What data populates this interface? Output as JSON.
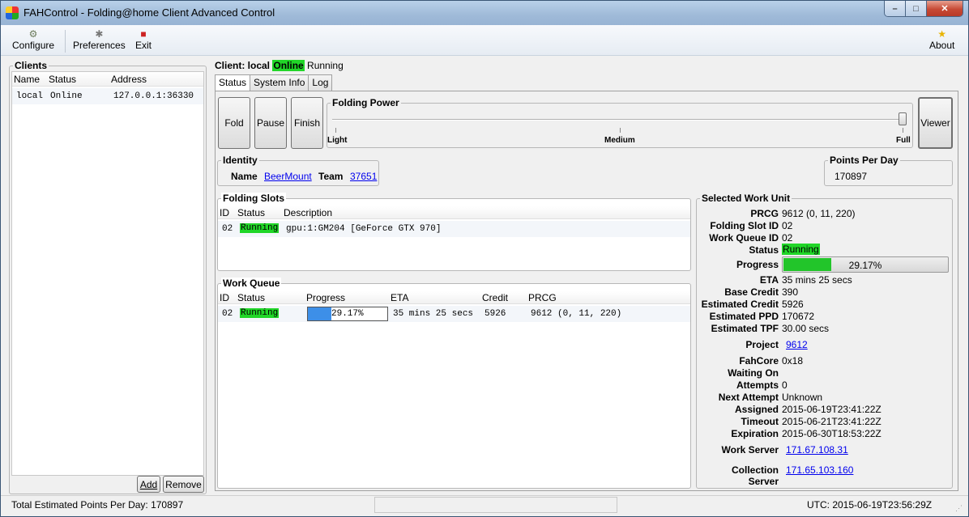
{
  "window": {
    "title": "FAHControl - Folding@home Client Advanced Control"
  },
  "toolbar": {
    "configure": "Configure",
    "preferences": "Preferences",
    "exit": "Exit",
    "about": "About"
  },
  "clients": {
    "title": "Clients",
    "columns": [
      "Name",
      "Status",
      "Address"
    ],
    "rows": [
      {
        "name": "local",
        "status": "Online",
        "address": "127.0.0.1:36330"
      }
    ],
    "add_label": "Add",
    "remove_label": "Remove"
  },
  "client_header": {
    "prefix": "Client: local",
    "online": "Online",
    "state": "Running"
  },
  "tabs": [
    "Status",
    "System Info",
    "Log"
  ],
  "controls": {
    "fold": "Fold",
    "pause": "Pause",
    "finish": "Finish",
    "viewer": "Viewer"
  },
  "folding_power": {
    "title": "Folding Power",
    "light": "Light",
    "medium": "Medium",
    "full": "Full",
    "level": 1.0
  },
  "identity": {
    "title": "Identity",
    "name_label": "Name",
    "name": "BeerMount",
    "team_label": "Team",
    "team": "37651"
  },
  "ppd": {
    "title": "Points Per Day",
    "value": "170897"
  },
  "slots": {
    "title": "Folding Slots",
    "columns": [
      "ID",
      "Status",
      "Description"
    ],
    "rows": [
      {
        "id": "02",
        "status": "Running",
        "description": "gpu:1:GM204 [GeForce GTX 970]"
      }
    ]
  },
  "queue": {
    "title": "Work Queue",
    "columns": [
      "ID",
      "Status",
      "Progress",
      "ETA",
      "Credit",
      "PRCG"
    ],
    "rows": [
      {
        "id": "02",
        "status": "Running",
        "progress": "29.17%",
        "progress_value": 0.2917,
        "eta": "35 mins 25 secs",
        "credit": "5926",
        "prcg": "9612 (0, 11, 220)"
      }
    ]
  },
  "wu": {
    "title": "Selected Work Unit",
    "prcg_label": "PRCG",
    "prcg": "9612 (0, 11, 220)",
    "slot_label": "Folding Slot ID",
    "slot": "02",
    "queue_label": "Work Queue ID",
    "queue": "02",
    "status_label": "Status",
    "status": "Running",
    "progress_label": "Progress",
    "progress": "29.17%",
    "progress_value": 0.2917,
    "eta_label": "ETA",
    "eta": "35 mins 25 secs",
    "base_credit_label": "Base Credit",
    "base_credit": "390",
    "est_credit_label": "Estimated Credit",
    "est_credit": "5926",
    "est_ppd_label": "Estimated PPD",
    "est_ppd": "170672",
    "est_tpf_label": "Estimated TPF",
    "est_tpf": "30.00 secs",
    "project_label": "Project",
    "project": "9612",
    "fahcore_label": "FahCore",
    "fahcore": "0x18",
    "waiting_label": "Waiting On",
    "waiting": "",
    "attempts_label": "Attempts",
    "attempts": "0",
    "next_attempt_label": "Next Attempt",
    "next_attempt": "Unknown",
    "assigned_label": "Assigned",
    "assigned": "2015-06-19T23:41:22Z",
    "timeout_label": "Timeout",
    "timeout": "2015-06-21T23:41:22Z",
    "expiration_label": "Expiration",
    "expiration": "2015-06-30T18:53:22Z",
    "work_server_label": "Work Server",
    "work_server": "171.67.108.31",
    "collection_server_label": "Collection Server",
    "collection_server": "171.65.103.160"
  },
  "statusbar": {
    "total": "Total Estimated Points Per Day: 170897",
    "utc": "UTC: 2015-06-19T23:56:29Z"
  },
  "colors": {
    "running": "#21d628",
    "progress_wu": "#22c52a",
    "progress_queue": "#3d8fe8"
  }
}
